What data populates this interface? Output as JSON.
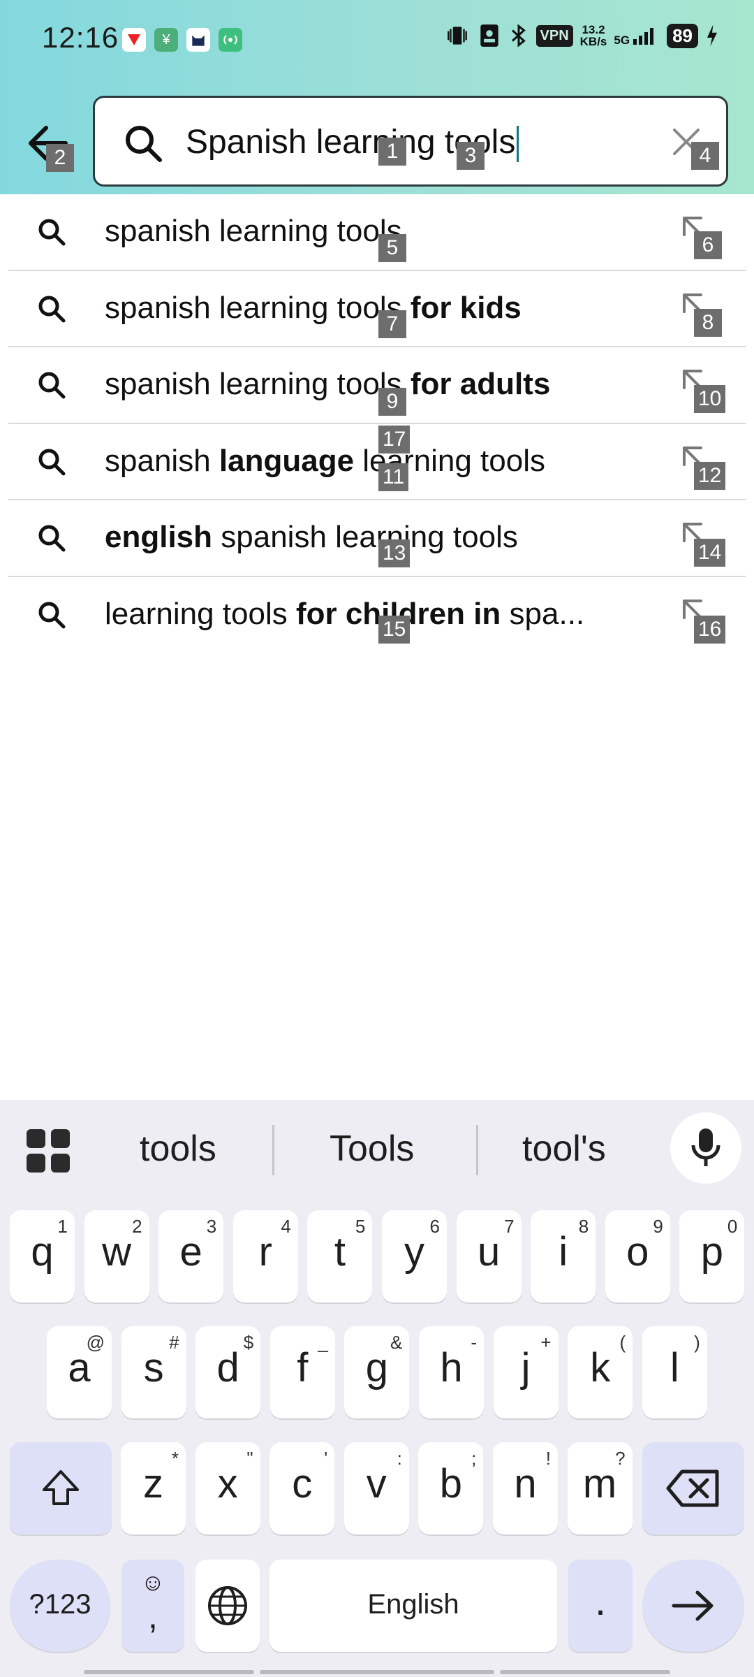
{
  "status_bar": {
    "time": "12:16",
    "vpn": "VPN",
    "net_speed_value": "13.2",
    "net_speed_unit": "KB/s",
    "network": "5G",
    "battery": "89"
  },
  "search": {
    "value": "Spanish learning tools"
  },
  "suggestions": [
    {
      "pre": "spanish learning tools",
      "bold": "",
      "post": ""
    },
    {
      "pre": "spanish learning tools ",
      "bold": "for kids",
      "post": ""
    },
    {
      "pre": "spanish learning tools ",
      "bold": "for adults",
      "post": ""
    },
    {
      "pre": "spanish ",
      "bold": "language",
      "post": " learning tools"
    },
    {
      "pre": "",
      "bold": "english",
      "post": " spanish learning tools"
    },
    {
      "pre": "learning tools ",
      "bold": "for children in",
      "post": " spa..."
    }
  ],
  "badges": {
    "b1": "1",
    "b2": "2",
    "b3": "3",
    "b4": "4",
    "b5": "5",
    "b6": "6",
    "b7": "7",
    "b8": "8",
    "b9": "9",
    "b10": "10",
    "b11": "11",
    "b12": "12",
    "b13": "13",
    "b14": "14",
    "b15": "15",
    "b16": "16",
    "b17": "17"
  },
  "keyboard": {
    "suggestions": [
      "tools",
      "Tools",
      "tool's"
    ],
    "row1": [
      {
        "k": "q",
        "s": "1"
      },
      {
        "k": "w",
        "s": "2"
      },
      {
        "k": "e",
        "s": "3"
      },
      {
        "k": "r",
        "s": "4"
      },
      {
        "k": "t",
        "s": "5"
      },
      {
        "k": "y",
        "s": "6"
      },
      {
        "k": "u",
        "s": "7"
      },
      {
        "k": "i",
        "s": "8"
      },
      {
        "k": "o",
        "s": "9"
      },
      {
        "k": "p",
        "s": "0"
      }
    ],
    "row2": [
      {
        "k": "a",
        "s": "@"
      },
      {
        "k": "s",
        "s": "#"
      },
      {
        "k": "d",
        "s": "$"
      },
      {
        "k": "f",
        "s": "_"
      },
      {
        "k": "g",
        "s": "&"
      },
      {
        "k": "h",
        "s": "-"
      },
      {
        "k": "j",
        "s": "+"
      },
      {
        "k": "k",
        "s": "("
      },
      {
        "k": "l",
        "s": ")"
      }
    ],
    "row3": [
      {
        "k": "z",
        "s": "*"
      },
      {
        "k": "x",
        "s": "\""
      },
      {
        "k": "c",
        "s": "'"
      },
      {
        "k": "v",
        "s": ":"
      },
      {
        "k": "b",
        "s": ";"
      },
      {
        "k": "n",
        "s": "!"
      },
      {
        "k": "m",
        "s": "?"
      }
    ],
    "symbols_label": "?123",
    "comma_key": ",",
    "space_label": "English",
    "period_key": "."
  },
  "colors": {
    "header_start": "#83d8de",
    "header_end": "#a7e6cf",
    "keyboard_bg": "#eeedf4",
    "modifier_key": "#dde0f6",
    "caret": "#0a7a7a"
  }
}
